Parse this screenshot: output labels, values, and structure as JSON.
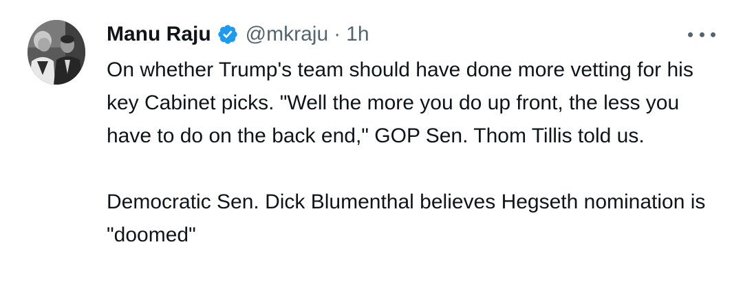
{
  "tweet": {
    "author": {
      "display_name": "Manu Raju",
      "handle": "@mkraju",
      "verified": true,
      "avatar_icon": "profile-photo"
    },
    "separator": "·",
    "time": "1h",
    "more_icon": "ellipsis-icon",
    "paragraphs": [
      "On whether Trump's team should have done more vetting for his key Cabinet picks. \"Well the more you do up front, the less you have to do on the back end,\" GOP Sen. Thom Tillis told us.",
      "Democratic Sen. Dick Blumenthal believes Hegseth nomination is \"doomed\""
    ]
  },
  "colors": {
    "text_primary": "#0f1419",
    "text_secondary": "#536471",
    "verified_blue": "#1d9bf0",
    "background": "#ffffff"
  }
}
